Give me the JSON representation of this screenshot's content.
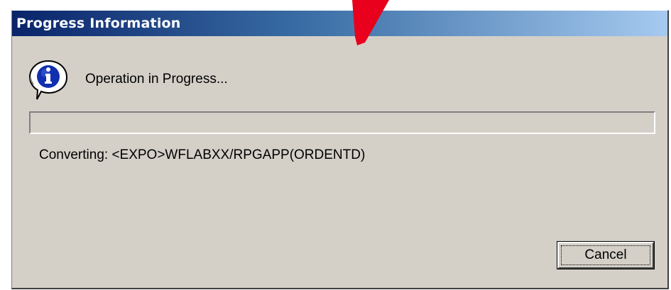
{
  "dialog": {
    "title": "Progress Information",
    "message": "Operation in Progress...",
    "status_text": "Converting: <EXPO>WFLABXX/RPGAPP(ORDENTD)",
    "progress_fraction": 0,
    "cancel_label": "Cancel",
    "icon": "info-icon"
  },
  "colors": {
    "title_start": "#0a246a",
    "title_end": "#a6caf0",
    "face": "#d4d0c8",
    "annotation_arrow": "#e8001c"
  }
}
